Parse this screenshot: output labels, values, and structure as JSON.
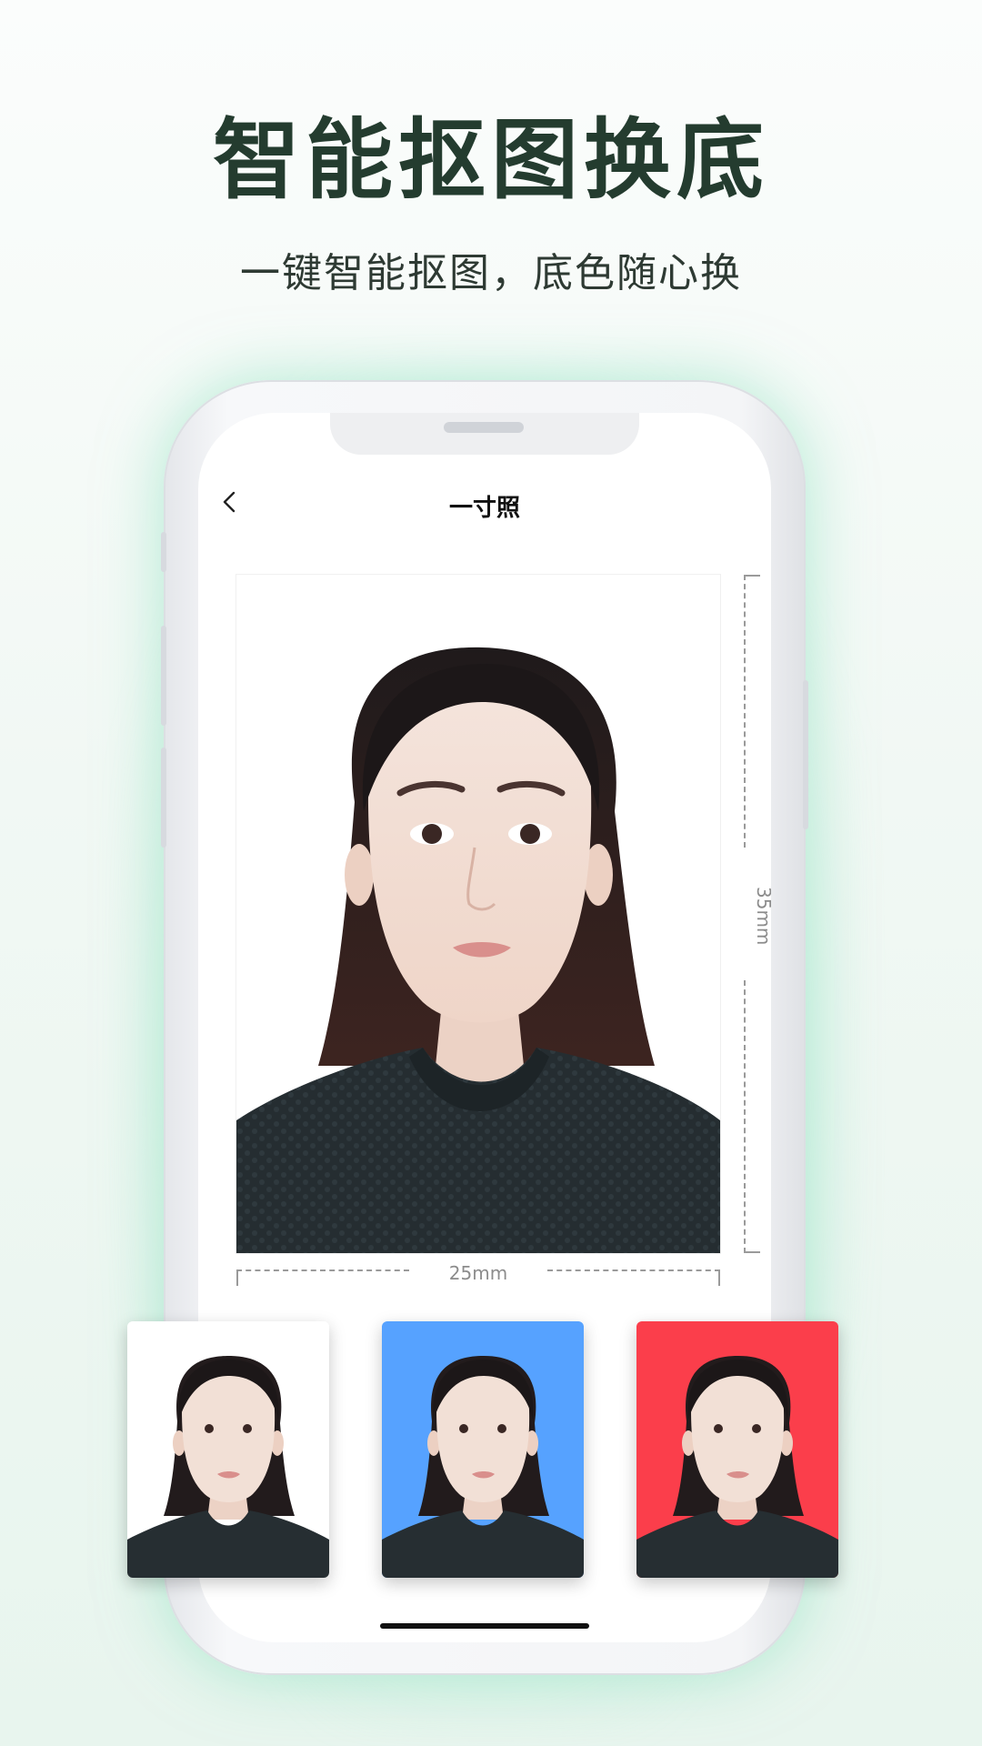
{
  "headline": "智能抠图换底",
  "subline": "一键智能抠图，底色随心换",
  "screen": {
    "nav_title": "一寸照",
    "back_icon": "chevron-left-icon",
    "photo": {
      "background": "#ffffff"
    },
    "dimension_height": "35mm",
    "dimension_width": "25mm"
  },
  "thumbnails": [
    {
      "name": "white-background",
      "color": "#ffffff"
    },
    {
      "name": "blue-background",
      "color": "#56a2ff"
    },
    {
      "name": "red-background",
      "color": "#fb3e4b"
    }
  ],
  "colors": {
    "headline": "#243c2f",
    "accent_glow": "#9be6c8"
  }
}
